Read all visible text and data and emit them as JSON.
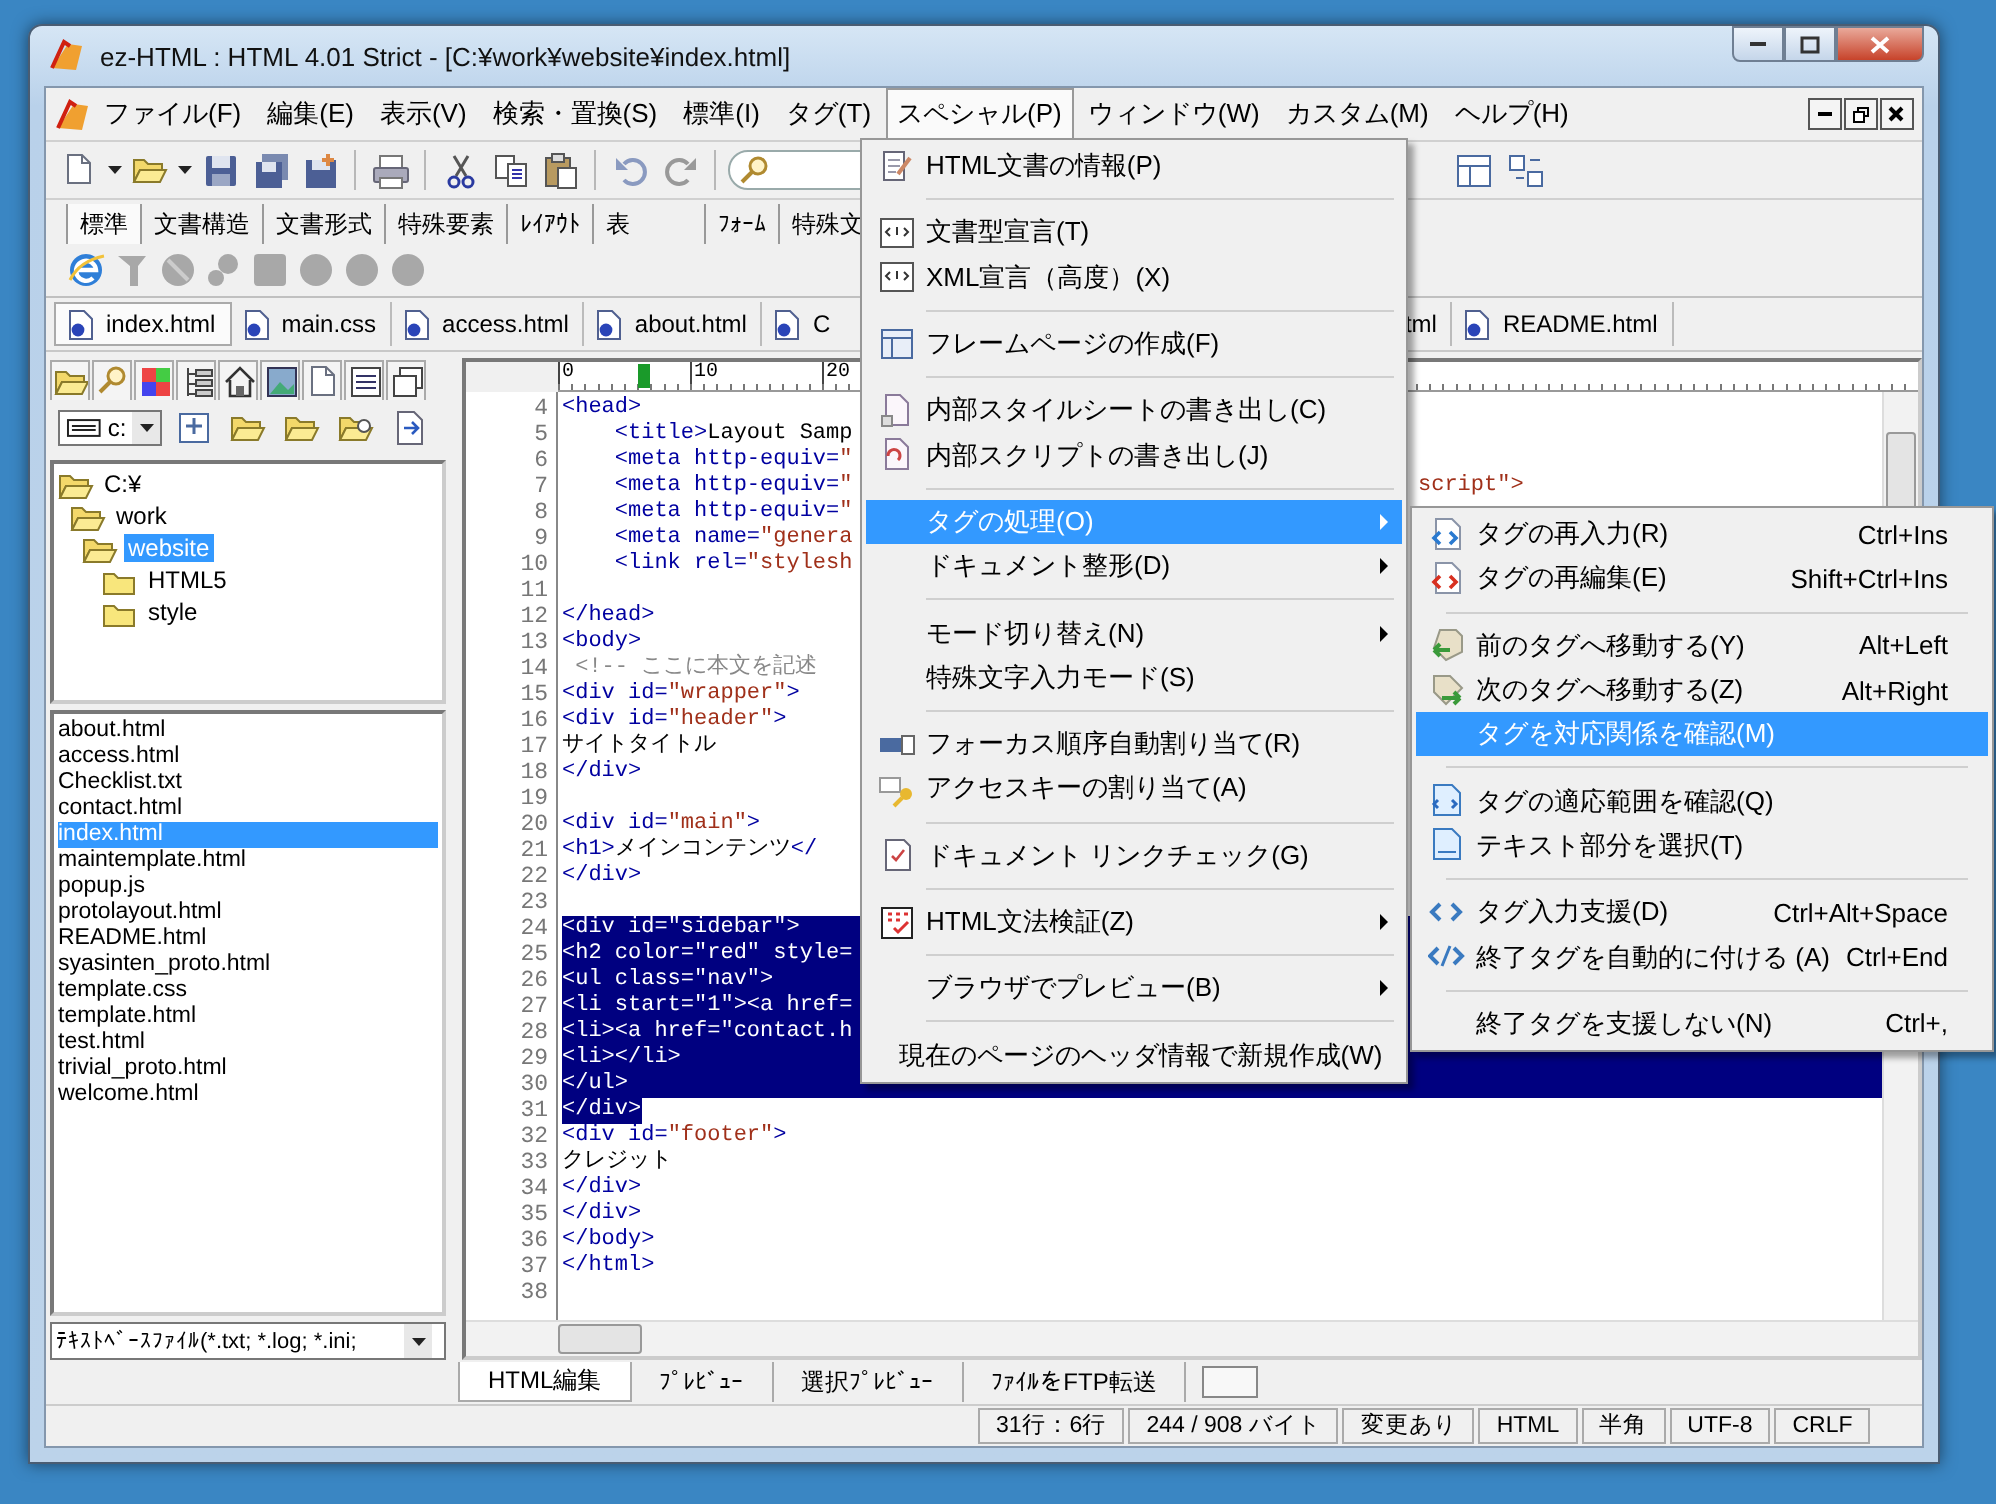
{
  "window": {
    "title": "ez-HTML : HTML 4.01 Strict - [C:¥work¥website¥index.html]"
  },
  "menu_bar": [
    {
      "label": "ファイル(F)",
      "selected": false
    },
    {
      "label": "編集(E)",
      "selected": false
    },
    {
      "label": "表示(V)",
      "selected": false
    },
    {
      "label": "検索・置換(S)",
      "selected": false
    },
    {
      "label": "標準(I)",
      "selected": false
    },
    {
      "label": "タグ(T)",
      "selected": false
    },
    {
      "label": "スペシャル(P)",
      "selected": true
    },
    {
      "label": "ウィンドウ(W)",
      "selected": false
    },
    {
      "label": "カスタム(M)",
      "selected": false
    },
    {
      "label": "ヘルプ(H)",
      "selected": false
    }
  ],
  "palette_tabs": [
    {
      "label": "標準",
      "selected": true
    },
    {
      "label": "文書構造",
      "selected": false
    },
    {
      "label": "文書形式",
      "selected": false
    },
    {
      "label": "特殊要素",
      "selected": false
    },
    {
      "label": "ﾚｲｱｳﾄ",
      "selected": false
    },
    {
      "label": "表",
      "selected": false
    },
    {
      "label": "ﾌｫｰﾑ",
      "selected": false
    },
    {
      "label": "特殊文",
      "selected": false
    }
  ],
  "file_tabs": [
    {
      "label": "index.html",
      "selected": true
    },
    {
      "label": "main.css",
      "selected": false
    },
    {
      "label": "access.html",
      "selected": false
    },
    {
      "label": "about.html",
      "selected": false
    },
    {
      "label": "C",
      "selected": false
    },
    {
      "label": "tml",
      "selected": false
    },
    {
      "label": "README.html",
      "selected": false
    }
  ],
  "sidebar": {
    "drive": "c:",
    "folders": [
      {
        "label": "C:¥",
        "selected": false,
        "children": [
          {
            "label": "work",
            "selected": false,
            "children": [
              {
                "label": "website",
                "selected": true,
                "children": [
                  {
                    "label": "HTML5",
                    "selected": false
                  },
                  {
                    "label": "style",
                    "selected": false
                  }
                ]
              }
            ]
          }
        ]
      }
    ],
    "files": [
      {
        "label": "about.html",
        "selected": false
      },
      {
        "label": "access.html",
        "selected": false
      },
      {
        "label": "Checklist.txt",
        "selected": false
      },
      {
        "label": "contact.html",
        "selected": false
      },
      {
        "label": "index.html",
        "selected": true
      },
      {
        "label": "maintemplate.html",
        "selected": false
      },
      {
        "label": "popup.js",
        "selected": false
      },
      {
        "label": "protolayout.html",
        "selected": false
      },
      {
        "label": "README.html",
        "selected": false
      },
      {
        "label": "syasinten_proto.html",
        "selected": false
      },
      {
        "label": "template.css",
        "selected": false
      },
      {
        "label": "template.html",
        "selected": false
      },
      {
        "label": "test.html",
        "selected": false
      },
      {
        "label": "trivial_proto.html",
        "selected": false
      },
      {
        "label": "welcome.html",
        "selected": false
      }
    ],
    "filter": "ﾃｷｽﾄﾍﾞｰｽﾌｧｲﾙ(*.txt; *.log; *.ini;"
  },
  "editor": {
    "ruler": [
      "0",
      "10",
      "20"
    ],
    "lines": [
      {
        "number": "4",
        "text": "<head>",
        "selected": false
      },
      {
        "number": "5",
        "text": "    <title>Layout Samp",
        "selected": false
      },
      {
        "number": "6",
        "text": "    <meta http-equiv=\"",
        "selected": false
      },
      {
        "number": "7",
        "text": "    <meta http-equiv=\"",
        "tail": "script\">",
        "selected": false
      },
      {
        "number": "8",
        "text": "    <meta http-equiv=\"",
        "selected": false
      },
      {
        "number": "9",
        "text": "    <meta name=\"genera",
        "selected": false
      },
      {
        "number": "10",
        "text": "    <link rel=\"stylesh",
        "selected": false
      },
      {
        "number": "11",
        "selected": false
      },
      {
        "number": "12",
        "text": "</head>",
        "selected": false
      },
      {
        "number": "13",
        "text": "<body>",
        "selected": false
      },
      {
        "number": "14",
        "text": " <!-- ここに本文を記述",
        "selected": false
      },
      {
        "number": "15",
        "text": "<div id=\"wrapper\">",
        "selected": false
      },
      {
        "number": "16",
        "text": "<div id=\"header\">",
        "selected": false
      },
      {
        "number": "17",
        "text": "サイトタイトル",
        "selected": false
      },
      {
        "number": "18",
        "text": "</div>",
        "selected": false
      },
      {
        "number": "19",
        "selected": false
      },
      {
        "number": "20",
        "text": "<div id=\"main\">",
        "selected": false
      },
      {
        "number": "21",
        "text": "<h1>メインコンテンツ</",
        "selected": false
      },
      {
        "number": "22",
        "text": "</div>",
        "selected": false
      },
      {
        "number": "23",
        "selected": false
      },
      {
        "number": "24",
        "text": "<div id=\"sidebar\">",
        "selected": true
      },
      {
        "number": "25",
        "text": "<h2 color=\"red\" style=",
        "selected": true
      },
      {
        "number": "26",
        "text": "<ul class=\"nav\">",
        "selected": true
      },
      {
        "number": "27",
        "text": "<li start=\"1\"><a href=",
        "selected": true
      },
      {
        "number": "28",
        "text": "<li><a href=\"contact.h",
        "selected": true
      },
      {
        "number": "29",
        "text": "<li></li>",
        "selected": true
      },
      {
        "number": "30",
        "text": "</ul>",
        "selected": true
      },
      {
        "number": "31",
        "text": "</div>",
        "selected": true
      },
      {
        "number": "32",
        "text": "<div id=\"footer\">",
        "selected": false
      },
      {
        "number": "33",
        "text": "クレジット",
        "selected": false
      },
      {
        "number": "34",
        "text": "</div>",
        "selected": false
      },
      {
        "number": "35",
        "text": "</div>",
        "selected": false
      },
      {
        "number": "36",
        "text": "</body>",
        "selected": false
      },
      {
        "number": "37",
        "text": "</html>",
        "selected": false
      },
      {
        "number": "38",
        "selected": false
      }
    ]
  },
  "bottom_tabs": [
    {
      "label": "HTML編集",
      "selected": true
    },
    {
      "label": "ﾌﾟﾚﾋﾞｭｰ",
      "selected": false
    },
    {
      "label": "選択ﾌﾟﾚﾋﾞｭｰ",
      "selected": false
    },
    {
      "label": "ﾌｧｲﾙをFTP転送",
      "selected": false
    }
  ],
  "status_bar": [
    "31行：6行",
    "244 / 908 バイト",
    "変更あり",
    "HTML",
    "半角",
    "UTF-8",
    "CRLF"
  ],
  "menu": {
    "items": [
      {
        "kind": "item",
        "label": "HTML文書の情報(P)",
        "selected": false,
        "submenu": false
      },
      {
        "kind": "separator"
      },
      {
        "kind": "item",
        "label": "文書型宣言(T)",
        "selected": false,
        "submenu": false
      },
      {
        "kind": "item",
        "label": "XML宣言（高度）(X)",
        "selected": false,
        "submenu": false
      },
      {
        "kind": "separator"
      },
      {
        "kind": "item",
        "label": "フレームページの作成(F)",
        "selected": false,
        "submenu": false
      },
      {
        "kind": "separator"
      },
      {
        "kind": "item",
        "label": "内部スタイルシートの書き出し(C)",
        "selected": false,
        "submenu": false
      },
      {
        "kind": "item",
        "label": "内部スクリプトの書き出し(J)",
        "selected": false,
        "submenu": false
      },
      {
        "kind": "separator"
      },
      {
        "kind": "item",
        "label": "タグの処理(O)",
        "selected": true,
        "submenu": true
      },
      {
        "kind": "item",
        "label": "ドキュメント整形(D)",
        "selected": false,
        "submenu": true
      },
      {
        "kind": "separator"
      },
      {
        "kind": "item",
        "label": "モード切り替え(N)",
        "selected": false,
        "submenu": true
      },
      {
        "kind": "item",
        "label": "特殊文字入力モード(S)",
        "selected": false,
        "submenu": false
      },
      {
        "kind": "separator"
      },
      {
        "kind": "item",
        "label": "フォーカス順序自動割り当て(R)",
        "selected": false,
        "submenu": false
      },
      {
        "kind": "item",
        "label": "アクセスキーの割り当て(A)",
        "selected": false,
        "submenu": false
      },
      {
        "kind": "separator"
      },
      {
        "kind": "item",
        "label": "ドキュメント リンクチェック(G)",
        "selected": false,
        "submenu": false
      },
      {
        "kind": "separator"
      },
      {
        "kind": "item",
        "label": "HTML文法検証(Z)",
        "selected": false,
        "submenu": true
      },
      {
        "kind": "separator"
      },
      {
        "kind": "item",
        "label": "ブラウザでプレビュー(B)",
        "selected": false,
        "submenu": true
      },
      {
        "kind": "separator"
      },
      {
        "kind": "item",
        "label": "現在のページのヘッダ情報で新規作成(W)",
        "selected": false,
        "submenu": false
      }
    ]
  },
  "submenu": {
    "items": [
      {
        "kind": "item",
        "label": "タグの再入力(R)",
        "shortcut": "Ctrl+Ins",
        "selected": false
      },
      {
        "kind": "item",
        "label": "タグの再編集(E)",
        "shortcut": "Shift+Ctrl+Ins",
        "selected": false
      },
      {
        "kind": "separator"
      },
      {
        "kind": "item",
        "label": "前のタグへ移動する(Y)",
        "shortcut": "Alt+Left",
        "selected": false
      },
      {
        "kind": "item",
        "label": "次のタグへ移動する(Z)",
        "shortcut": "Alt+Right",
        "selected": false
      },
      {
        "kind": "item",
        "label": "タグを対応関係を確認(M)",
        "selected": true
      },
      {
        "kind": "separator"
      },
      {
        "kind": "item",
        "label": "タグの適応範囲を確認(Q)",
        "selected": false
      },
      {
        "kind": "item",
        "label": "テキスト部分を選択(T)",
        "selected": false
      },
      {
        "kind": "separator"
      },
      {
        "kind": "item",
        "label": "タグ入力支援(D)",
        "shortcut": "Ctrl+Alt+Space",
        "selected": false
      },
      {
        "kind": "item",
        "label": "終了タグを自動的に付ける (A)",
        "shortcut": "Ctrl+End",
        "selected": false
      },
      {
        "kind": "separator"
      },
      {
        "kind": "item",
        "label": "終了タグを支援しない(N)",
        "shortcut": "Ctrl+,",
        "selected": false
      }
    ]
  }
}
